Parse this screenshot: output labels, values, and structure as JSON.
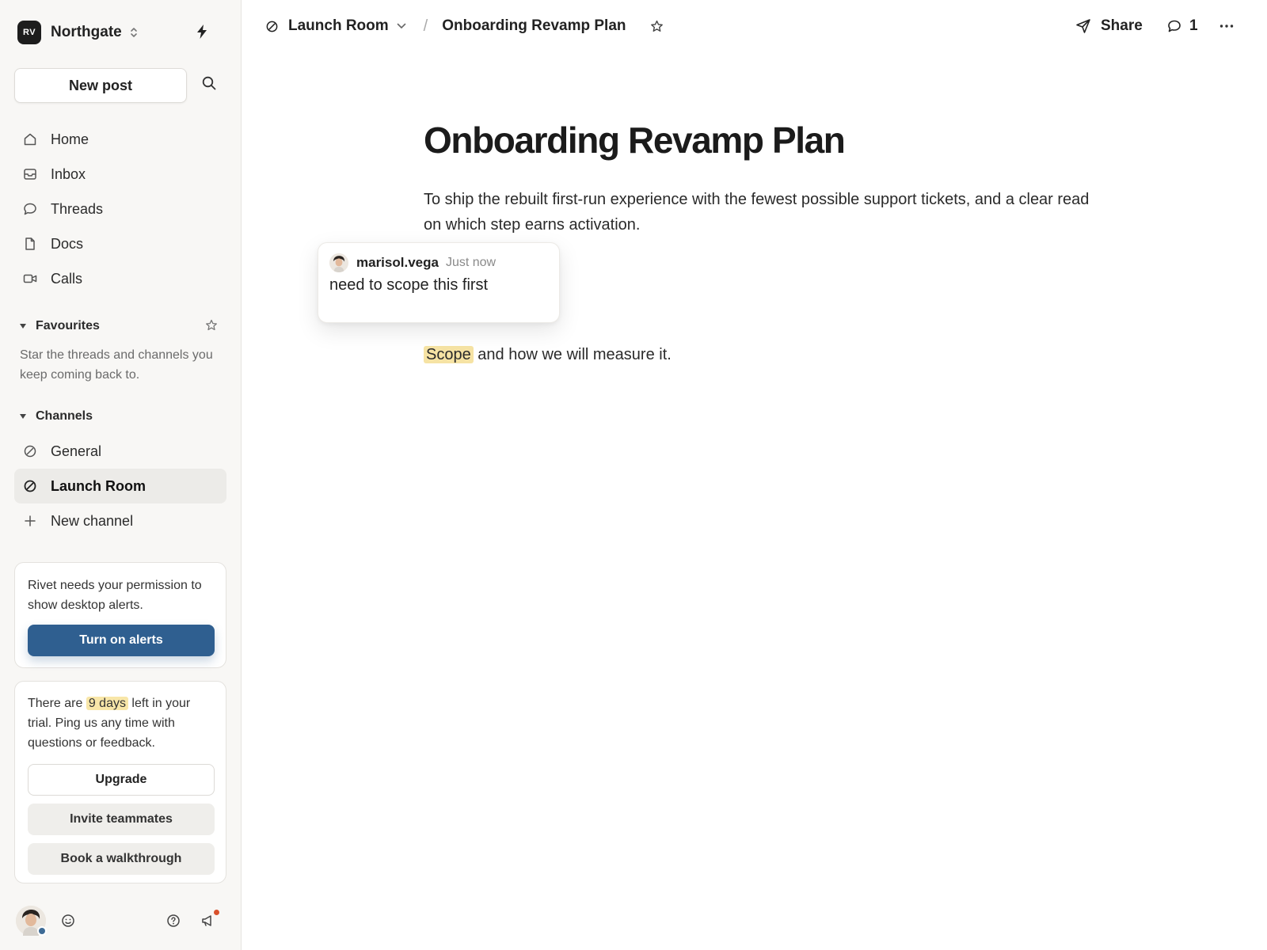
{
  "workspace": {
    "initials": "RV",
    "name": "Northgate"
  },
  "sidebar": {
    "new_post_label": "New post",
    "nav": [
      {
        "label": "Home",
        "icon": "home-icon"
      },
      {
        "label": "Inbox",
        "icon": "inbox-icon"
      },
      {
        "label": "Threads",
        "icon": "threads-icon"
      },
      {
        "label": "Docs",
        "icon": "docs-icon"
      },
      {
        "label": "Calls",
        "icon": "calls-icon"
      }
    ],
    "favourites": {
      "title": "Favourites",
      "hint": "Star the threads and channels you keep coming back to."
    },
    "channels": {
      "title": "Channels",
      "items": [
        {
          "label": "General",
          "active": false
        },
        {
          "label": "Launch Room",
          "active": true
        }
      ],
      "new_channel_label": "New channel"
    },
    "alerts_card": {
      "text": "Rivet needs your permission to show desktop alerts.",
      "button": "Turn on alerts"
    },
    "trial_card": {
      "text_before": "There are",
      "highlight": "9 days",
      "text_after": "left in your trial. Ping us any time with questions or feedback.",
      "upgrade": "Upgrade",
      "invite": "Invite teammates",
      "walkthrough": "Book a walkthrough"
    }
  },
  "topbar": {
    "channel": "Launch Room",
    "separator": "/",
    "doc_title": "Onboarding Revamp Plan",
    "share_label": "Share",
    "comment_count": "1"
  },
  "document": {
    "title": "Onboarding Revamp Plan",
    "paragraph1": "To ship the rebuilt first-run experience with the fewest possible support tickets, and a clear read on which step earns activation.",
    "p2_highlight": "Scope",
    "p2_rest": " and how we will measure it."
  },
  "comment": {
    "user": "marisol.vega",
    "time": "Just now",
    "text": "need to scope this first"
  },
  "colors": {
    "accent": "#2f5f90",
    "highlight": "#f6e3a4",
    "notification_dot": "#d9512c",
    "sidebar_bg": "#f8f7f5"
  }
}
